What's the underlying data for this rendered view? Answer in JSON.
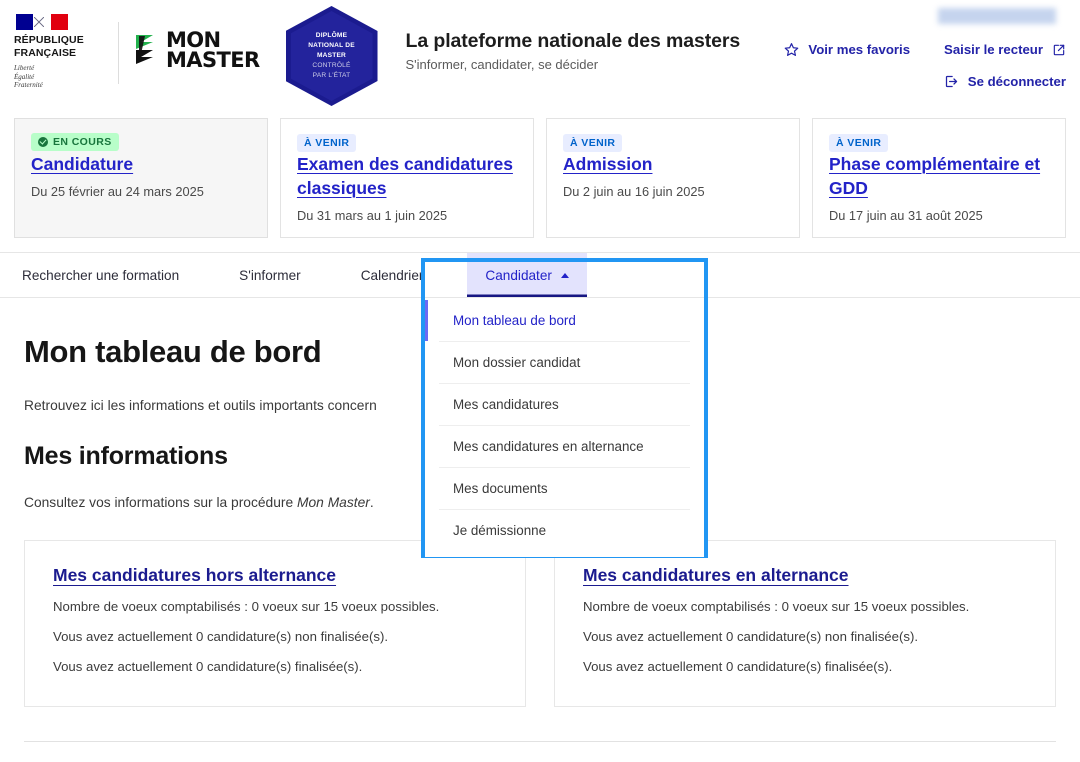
{
  "header": {
    "republic": {
      "line1": "RÉPUBLIQUE",
      "line2": "FRANÇAISE",
      "devise1": "Liberté",
      "devise2": "Égalité",
      "devise3": "Fraternité"
    },
    "logo": {
      "word1": "MON",
      "word2": "MASTER"
    },
    "dnm_badge": {
      "l1": "DIPLÔME",
      "l2": "NATIONAL DE",
      "l3": "MASTER",
      "l4": "CONTRÔLÉ",
      "l5": "PAR L'ÉTAT"
    },
    "platform": {
      "title": "La plateforme nationale des masters",
      "subtitle": "S'informer, candidater, se décider"
    },
    "actions": {
      "favorites": "Voir mes favoris",
      "rector": "Saisir le recteur",
      "logout": "Se déconnecter"
    }
  },
  "phases": [
    {
      "status": "EN COURS",
      "status_type": "current",
      "title": "Candidature",
      "dates": "Du 25 février au 24 mars 2025"
    },
    {
      "status": "À VENIR",
      "status_type": "upcoming",
      "title": "Examen des candidatures classiques",
      "dates": "Du 31 mars au 1 juin 2025"
    },
    {
      "status": "À VENIR",
      "status_type": "upcoming",
      "title": "Admission",
      "dates": "Du 2 juin au 16 juin 2025"
    },
    {
      "status": "À VENIR",
      "status_type": "upcoming",
      "title": "Phase complémentaire et GDD",
      "dates": "Du 17 juin au 31 août 2025"
    }
  ],
  "nav": {
    "items": [
      {
        "label": "Rechercher une formation",
        "active": false
      },
      {
        "label": "S'informer",
        "active": false
      },
      {
        "label": "Calendrier",
        "active": false
      },
      {
        "label": "Candidater",
        "active": true
      }
    ]
  },
  "dropdown": {
    "items": [
      {
        "label": "Mon tableau de bord",
        "active": true
      },
      {
        "label": "Mon dossier candidat",
        "active": false
      },
      {
        "label": "Mes candidatures",
        "active": false
      },
      {
        "label": "Mes candidatures en alternance",
        "active": false
      },
      {
        "label": "Mes documents",
        "active": false
      },
      {
        "label": "Je démissionne",
        "active": false
      }
    ]
  },
  "main": {
    "page_title": "Mon tableau de bord",
    "lede": "Retrouvez ici les informations et outils importants concern",
    "section_title": "Mes informations",
    "paragraph_prefix": "Consultez vos informations sur la procédure ",
    "paragraph_em": "Mon Master",
    "paragraph_suffix": ".",
    "cards": [
      {
        "title": "Mes candidatures hors alternance",
        "line1": "Nombre de voeux comptabilisés : 0 voeux sur 15 voeux possibles.",
        "line2": "Vous avez actuellement 0 candidature(s) non finalisée(s).",
        "line3": "Vous avez actuellement 0 candidature(s) finalisée(s)."
      },
      {
        "title": "Mes candidatures en alternance",
        "line1": "Nombre de voeux comptabilisés : 0 voeux sur 15 voeux possibles.",
        "line2": "Vous avez actuellement 0 candidature(s) non finalisée(s).",
        "line3": "Vous avez actuellement 0 candidature(s) finalisée(s)."
      }
    ]
  },
  "colors": {
    "brand_blue": "#2323c8",
    "dark_blue": "#1b1b8f",
    "focus_blue": "#2196f3",
    "active_tab_bg": "#e3e3fd",
    "badge_green_bg": "#b8fec9",
    "badge_green_fg": "#18753c",
    "badge_blue_bg": "#e8edff",
    "badge_blue_fg": "#0063cb",
    "flag_blue": "#000091",
    "flag_red": "#e1000f",
    "logo_green": "#22b14c"
  }
}
